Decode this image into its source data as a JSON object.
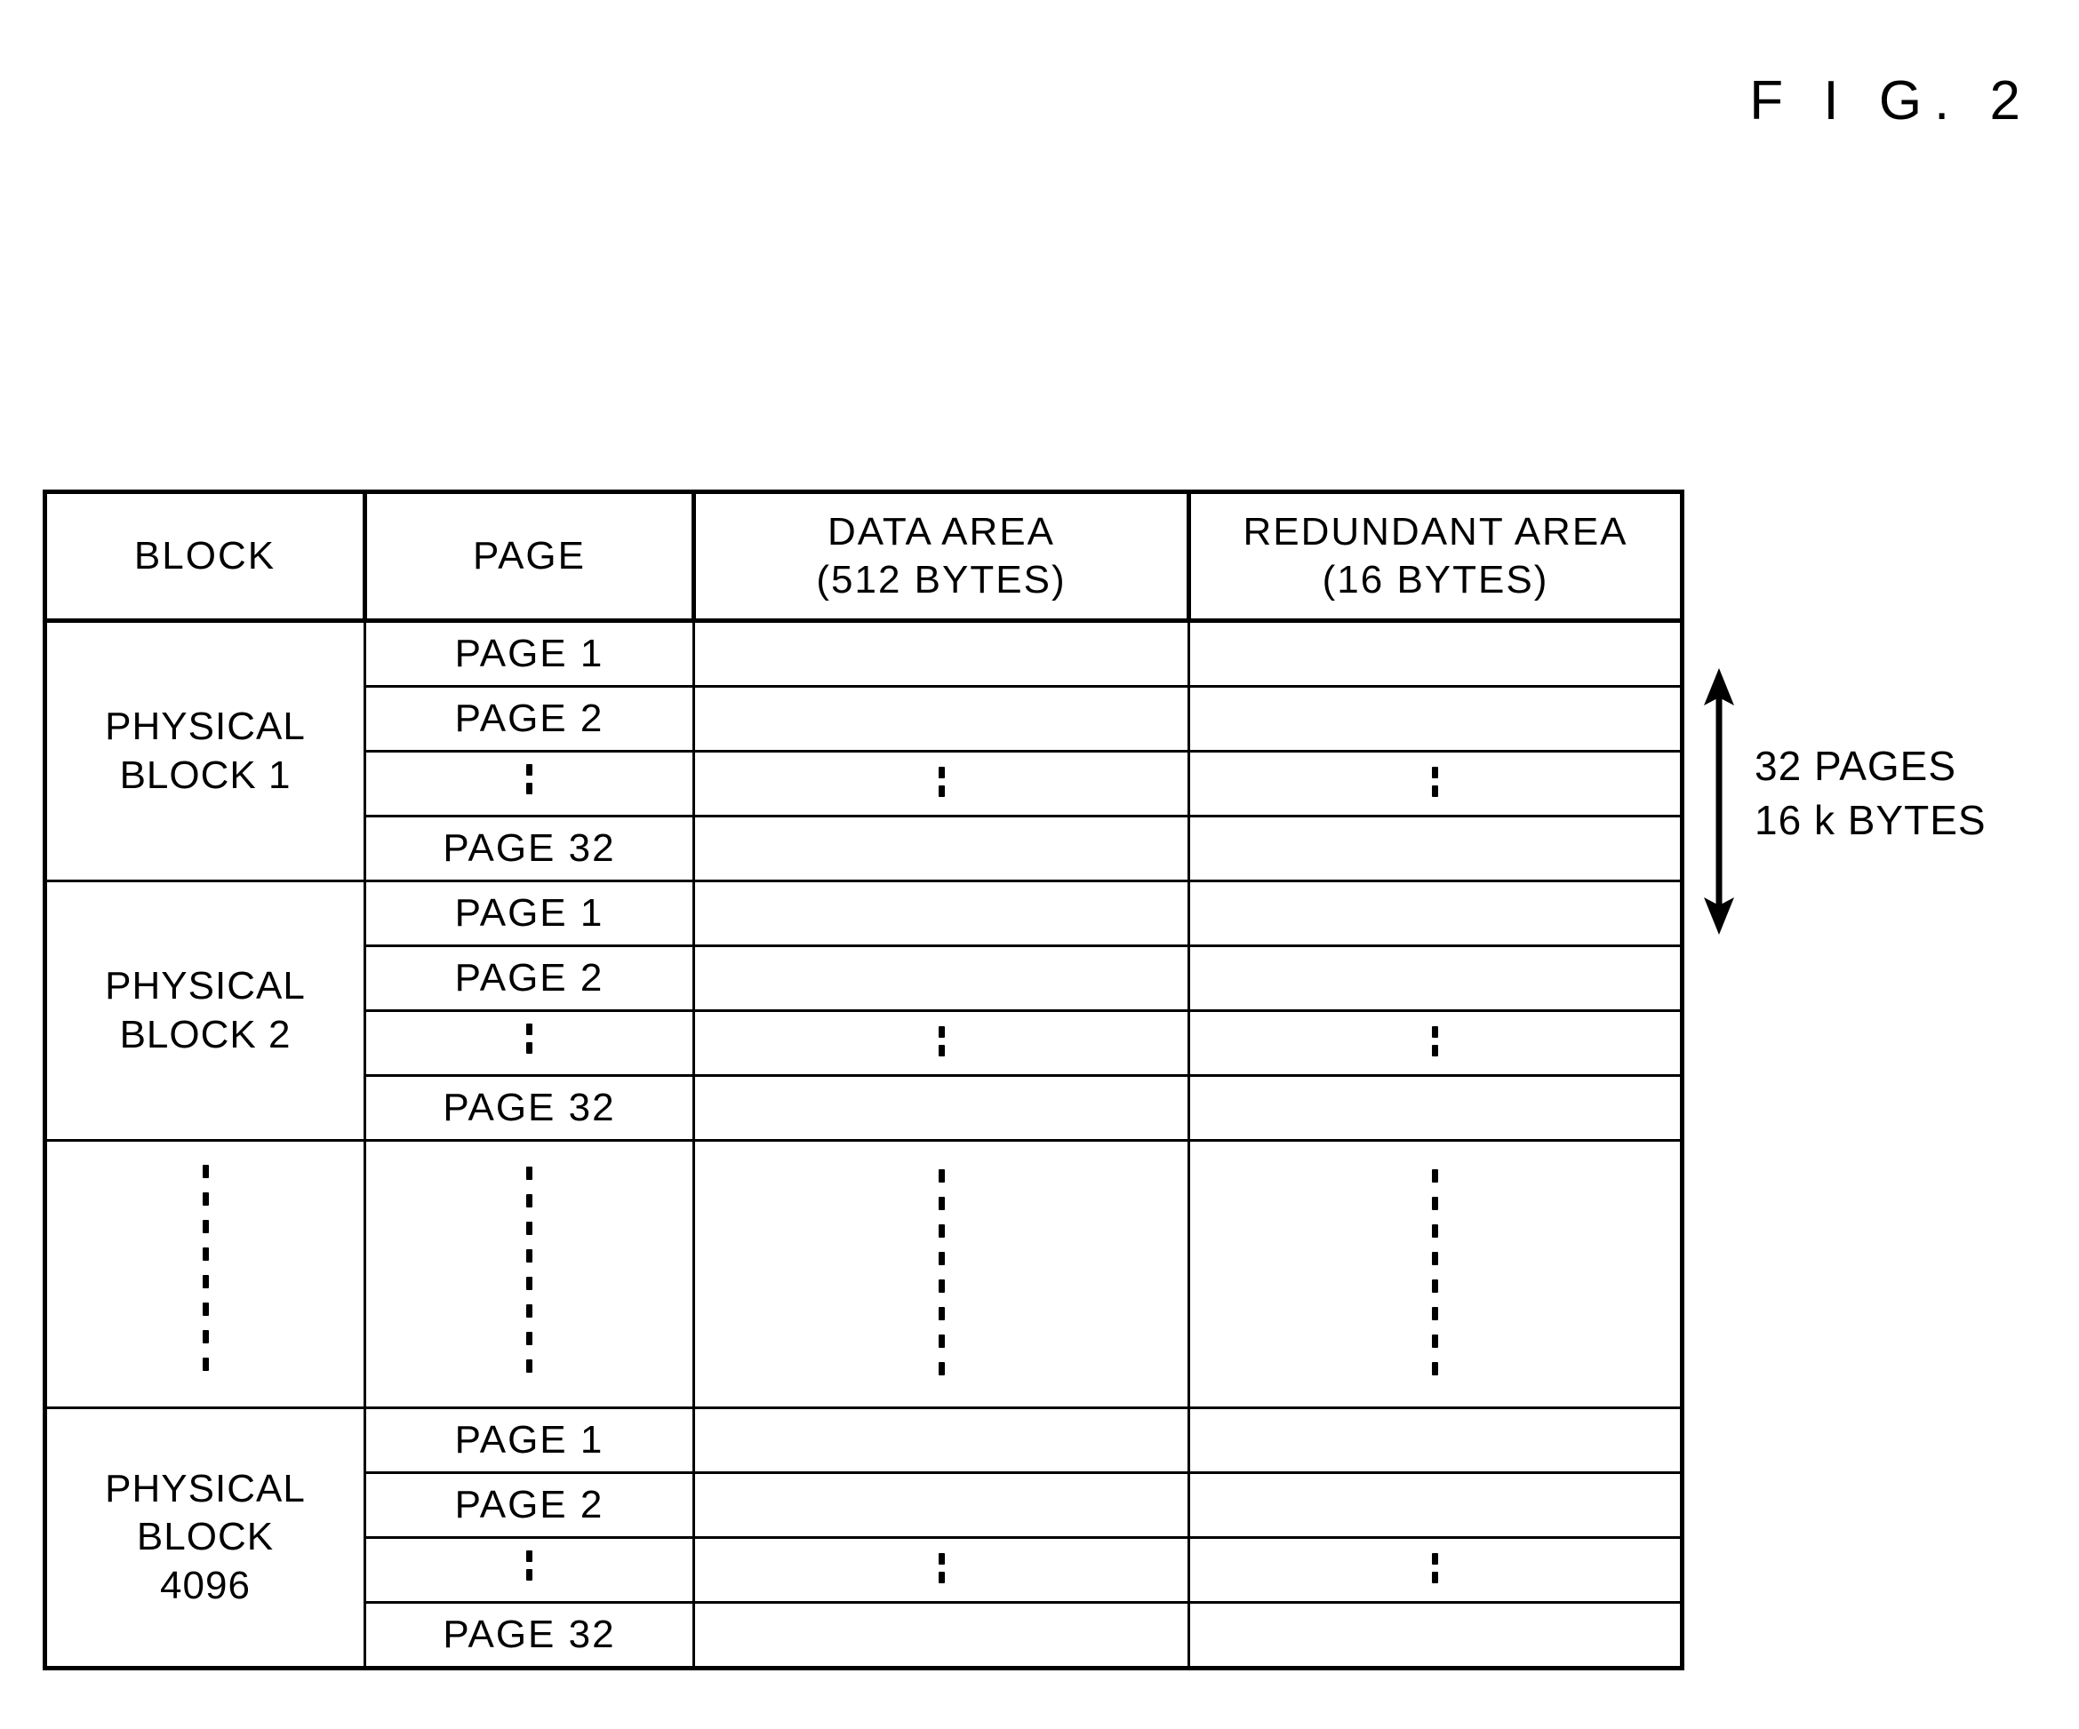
{
  "figure": {
    "title": "F I G.  2"
  },
  "table": {
    "headers": [
      "BLOCK",
      "PAGE",
      "DATA AREA\n(512 BYTES)",
      "REDUNDANT AREA\n(16 BYTES)"
    ],
    "header_lines": {
      "block": "BLOCK",
      "page": "PAGE",
      "data_area_l1": "DATA AREA",
      "data_area_l2": "(512 BYTES)",
      "redundant_area_l1": "REDUNDANT AREA",
      "redundant_area_l2": "(16 BYTES)"
    },
    "groups": [
      {
        "block_label": "PHYSICAL\nBLOCK 1",
        "rows": [
          {
            "page": "PAGE 1",
            "data": "",
            "redundant": ""
          },
          {
            "page": "PAGE 2",
            "data": "",
            "redundant": ""
          },
          {
            "page": "⋮",
            "data": "⋮",
            "redundant": "⋮"
          },
          {
            "page": "PAGE 32",
            "data": "",
            "redundant": ""
          }
        ]
      },
      {
        "block_label": "PHYSICAL\nBLOCK 2",
        "rows": [
          {
            "page": "PAGE 1",
            "data": "",
            "redundant": ""
          },
          {
            "page": "PAGE 2",
            "data": "",
            "redundant": ""
          },
          {
            "page": "⋮",
            "data": "⋮",
            "redundant": "⋮"
          },
          {
            "page": "PAGE 32",
            "data": "",
            "redundant": ""
          }
        ]
      },
      {
        "block_label": "⋮",
        "is_gap": true,
        "rows": [
          {
            "page": "⋮",
            "data": "⋮",
            "redundant": "⋮"
          }
        ]
      },
      {
        "block_label": "PHYSICAL\nBLOCK\n4096",
        "rows": [
          {
            "page": "PAGE 1",
            "data": "",
            "redundant": ""
          },
          {
            "page": "PAGE 2",
            "data": "",
            "redundant": ""
          },
          {
            "page": "⋮",
            "data": "⋮",
            "redundant": "⋮"
          },
          {
            "page": "PAGE 32",
            "data": "",
            "redundant": ""
          }
        ]
      }
    ]
  },
  "annotation": {
    "pages_label_line1": "32 PAGES",
    "pages_label_line2": "16 k BYTES",
    "pages_label": "32 PAGES\n16 k BYTES",
    "arrow_kind": "double-headed-vertical-arrow"
  },
  "colors": {
    "ink": "#000000",
    "background": "#ffffff"
  }
}
